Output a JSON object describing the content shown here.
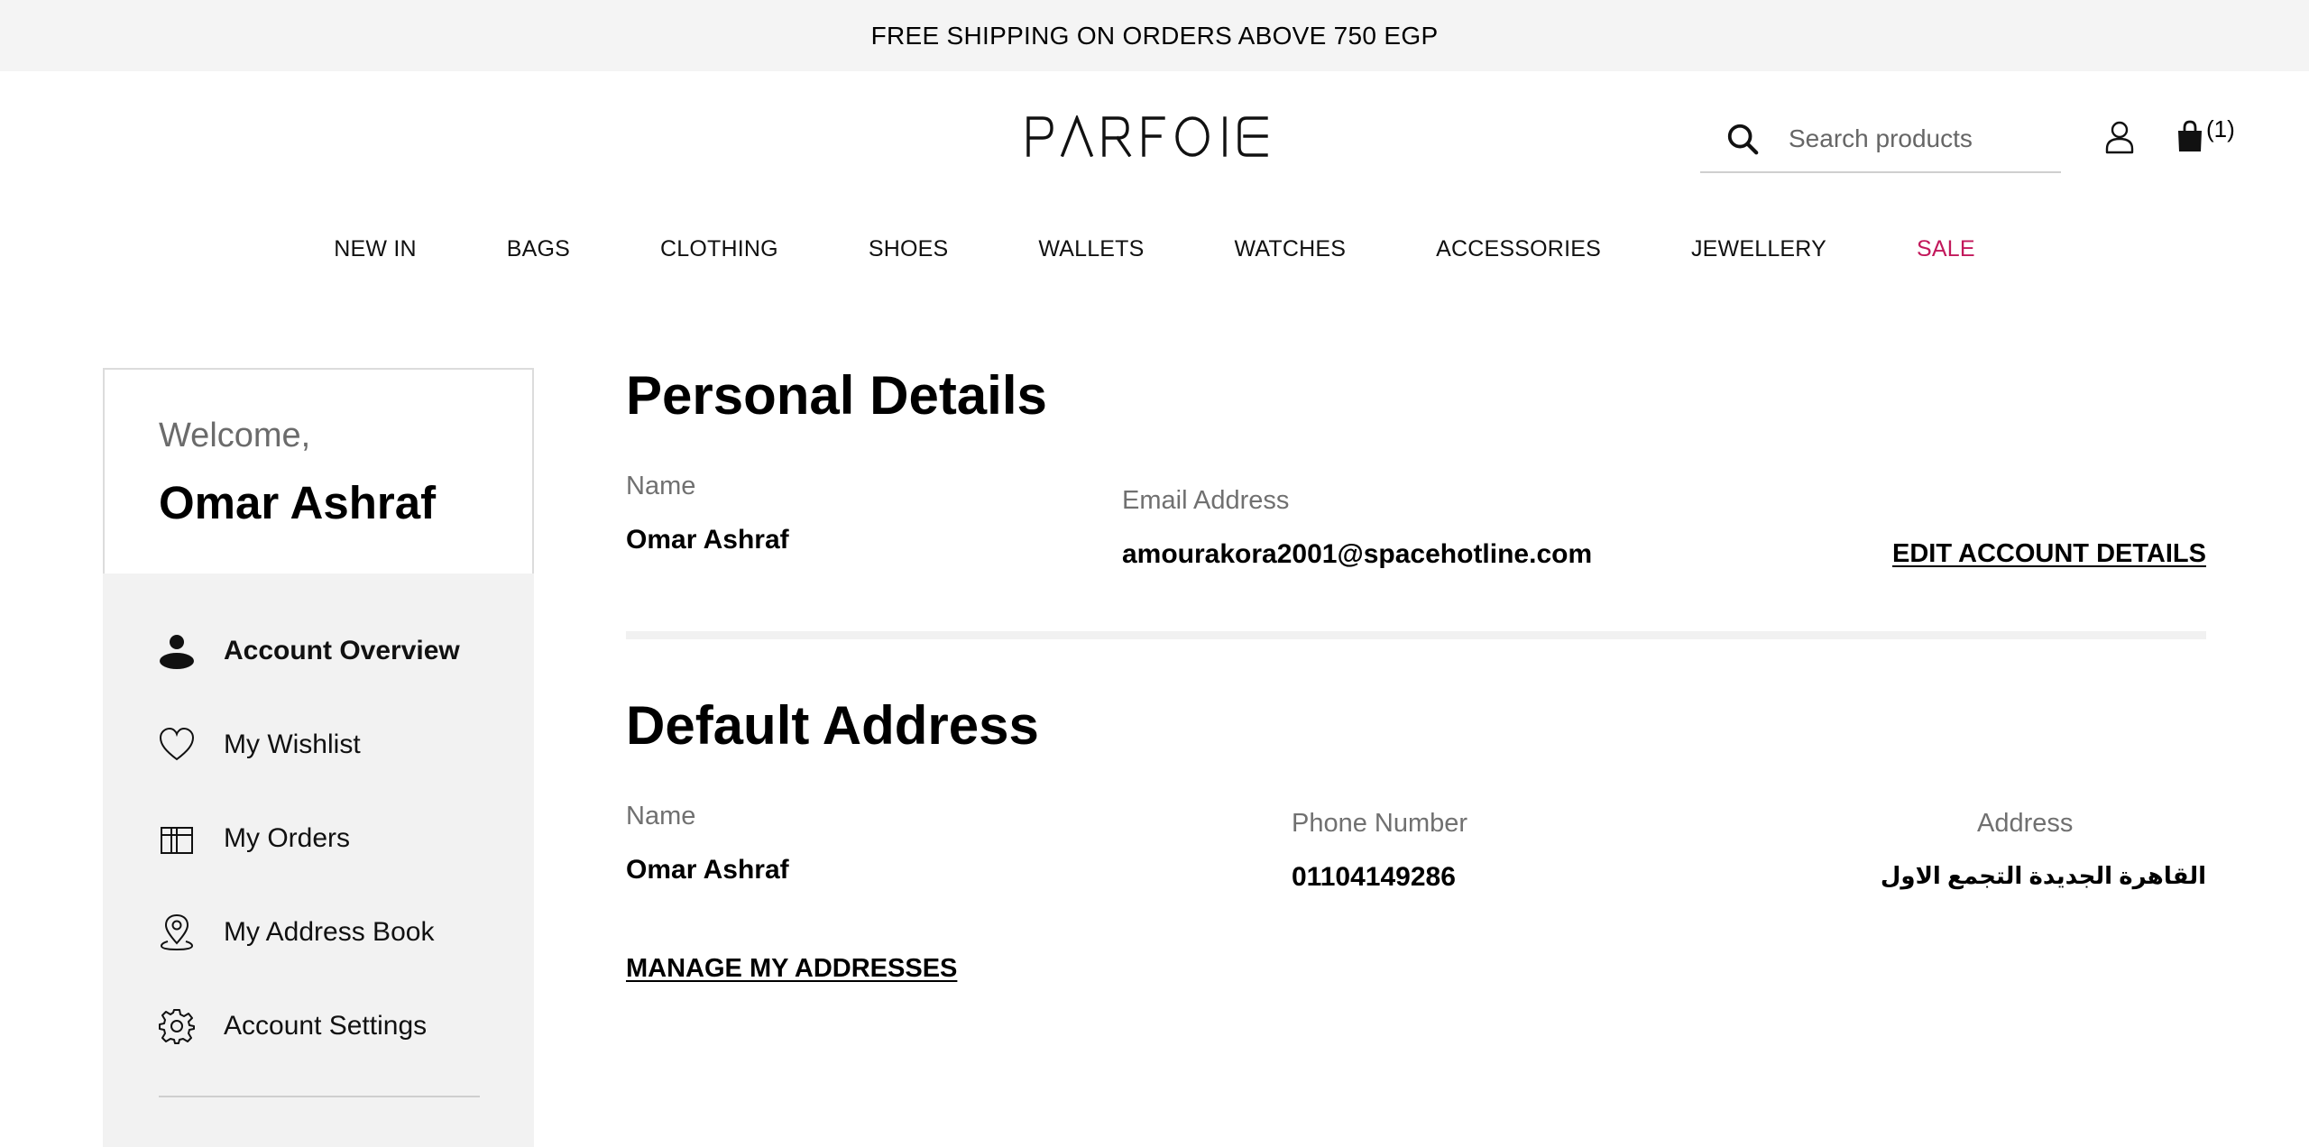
{
  "promo": {
    "text": "FREE SHIPPING ON ORDERS ABOVE 750 EGP"
  },
  "header": {
    "logo": "PARFOIS",
    "search_placeholder": "Search products",
    "cart_count": "(1)"
  },
  "nav": {
    "items": [
      "NEW IN",
      "BAGS",
      "CLOTHING",
      "SHOES",
      "WALLETS",
      "WATCHES",
      "ACCESSORIES",
      "JEWELLERY",
      "SALE"
    ],
    "sale_color": "#c2185b"
  },
  "sidebar": {
    "welcome": "Welcome,",
    "user_name": "Omar Ashraf",
    "items": [
      {
        "label": "Account Overview",
        "icon": "person-icon"
      },
      {
        "label": "My Wishlist",
        "icon": "heart-icon"
      },
      {
        "label": "My Orders",
        "icon": "gift-box-icon"
      },
      {
        "label": "My Address Book",
        "icon": "location-pin-icon"
      },
      {
        "label": "Account Settings",
        "icon": "gear-icon"
      }
    ]
  },
  "personal": {
    "title": "Personal Details",
    "name_label": "Name",
    "name_value": "Omar Ashraf",
    "email_label": "Email Address",
    "email_value": "amourakora2001@spacehotline.com",
    "edit_link": "EDIT ACCOUNT DETAILS"
  },
  "address": {
    "title": "Default Address",
    "name_label": "Name",
    "name_value": "Omar Ashraf",
    "phone_label": "Phone Number",
    "phone_value": "01104149286",
    "address_label": "Address",
    "address_value": "القاهرة الجديدة التجمع الاول",
    "manage_link": "MANAGE MY ADDRESSES"
  }
}
